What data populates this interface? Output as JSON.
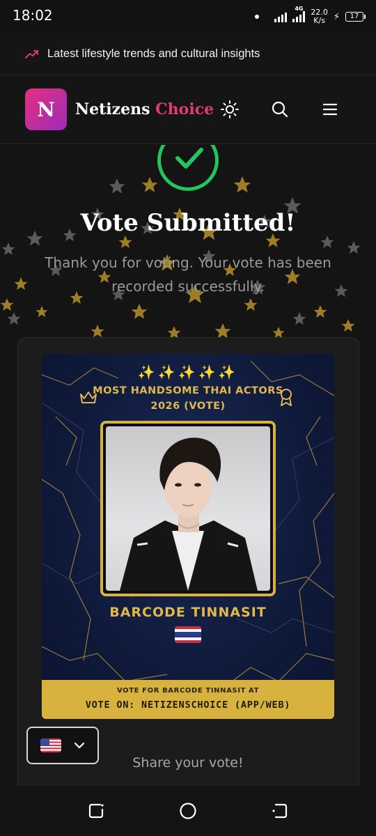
{
  "status_bar": {
    "time": "18:02",
    "network_type": "4G",
    "net_speed_value": "22.0",
    "net_speed_unit": "K/s",
    "battery_level": "17"
  },
  "trend_bar": {
    "icon": "trending-up-icon",
    "text": "Latest lifestyle trends and cultural insights"
  },
  "header": {
    "logo_letter": "N",
    "brand_part1": "Netizens",
    "brand_part2": "Choice",
    "icons": [
      "sun-icon",
      "search-icon",
      "menu-icon"
    ]
  },
  "main": {
    "title": "Vote Submitted!",
    "message": "Thank you for voting. Your vote has been recorded successfully.",
    "card": {
      "sparkles": "✨✨✨✨✨",
      "title": "MOST HANDSOME THAI ACTORS 2026 (VOTE)",
      "actor_name": "BARCODE TINNASIT",
      "footer_small": "VOTE FOR BARCODE TINNASIT AT",
      "footer_big": "VOTE ON: NETIZENSCHOICE (APP/WEB)"
    },
    "share_text": "Share your vote!",
    "language_selector": {
      "flag": "us-flag-icon",
      "chevron": "chevron-down-icon"
    }
  },
  "colors": {
    "accent_pink": "#e03a7a",
    "success_green": "#22c55e",
    "gold": "#e0b84b",
    "navy": "#0f1a3a"
  }
}
